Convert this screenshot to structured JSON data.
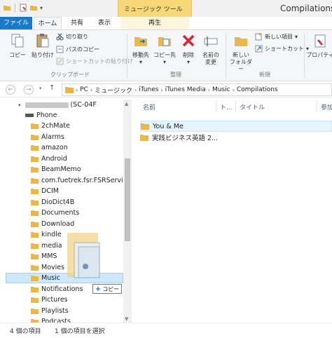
{
  "window": {
    "title": "Compilations",
    "context_band": "ミュージック ツール"
  },
  "tabs": {
    "file": "ファイル",
    "home": "ホーム",
    "share": "共有",
    "view": "表示",
    "play": "再生"
  },
  "ribbon": {
    "copy": "コピー",
    "paste": "貼り付け",
    "cut": "切り取り",
    "copy_path": "パスのコピー",
    "paste_shortcut": "ショートカットの貼り付け",
    "clipboard_group": "クリップボード",
    "move_to_line1": "移動先",
    "copy_to_line1": "コピー先",
    "delete": "削除",
    "rename_line1": "名前の",
    "rename_line2": "変更",
    "organize_group": "整理",
    "new_folder_line1": "新しい",
    "new_folder_line2": "フォルダー",
    "new_item": "新しい項目",
    "shortcut": "ショートカット",
    "new_group": "新規",
    "properties": "プロパティ"
  },
  "address": {
    "crumbs": [
      "PC",
      "ミュージック",
      "iTunes",
      "iTunes Media",
      "Music",
      "Compilations"
    ]
  },
  "nav": {
    "device": "(SC-04F",
    "phone": "Phone",
    "folders": [
      "2chMate",
      "Alarms",
      "amazon",
      "Android",
      "BeamMemo",
      "com.fuetrek.fsr.FSRService",
      "DCIM",
      "DioDict4B",
      "Documents",
      "Download",
      "kindle",
      "media",
      "MMS",
      "Movies",
      "Music",
      "Notifications",
      "Pictures",
      "Playlists",
      "Podcasts"
    ],
    "selected": "Music"
  },
  "content": {
    "columns": {
      "name": "名前",
      "track": "ト...",
      "title": "タイトル",
      "artist": "参加"
    },
    "items": [
      "You & Me",
      "実践ビジネス英語 2..."
    ]
  },
  "drag": {
    "tooltip": "コピー"
  },
  "status": {
    "count": "4 個の項目",
    "selected": "1 個の項目を選択"
  },
  "colors": {
    "accent": "#1979ca",
    "folder": "#e8b84a",
    "context": "#f7d777",
    "selection": "#cce8ff"
  }
}
